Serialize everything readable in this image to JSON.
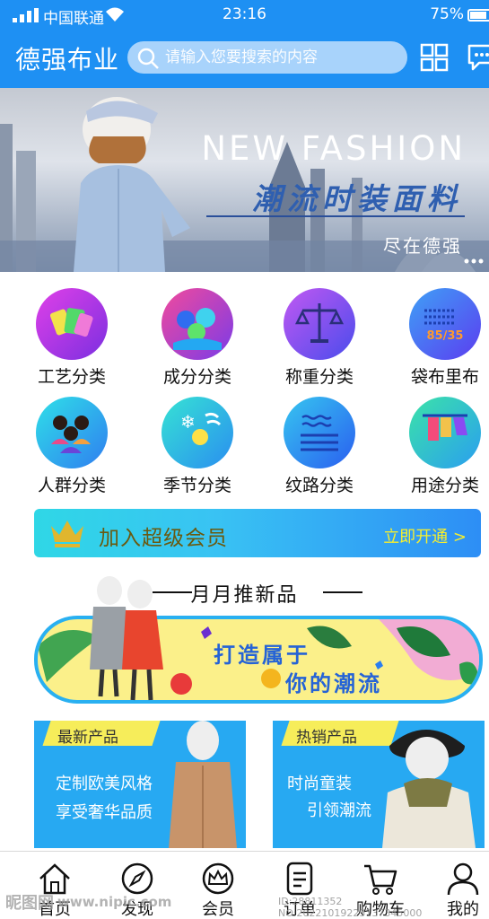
{
  "status_bar": {
    "carrier": "中国联通",
    "time": "23:16",
    "battery": "75%",
    "battery_level": 0.75
  },
  "header": {
    "brand": "德强布业",
    "search_placeholder": "请输入您要搜索的内容",
    "grid_icon": "grid-icon",
    "message_icon": "message-icon"
  },
  "banner": {
    "title": "NEW FASHION",
    "subtitle": "潮流时装面料",
    "tagline": "尽在德强"
  },
  "categories": [
    {
      "label": "工艺分类",
      "icon": "craft-icon"
    },
    {
      "label": "成分分类",
      "icon": "composition-icon"
    },
    {
      "label": "称重分类",
      "icon": "scale-icon"
    },
    {
      "label": "袋布里布",
      "icon": "pocket-lining-icon"
    },
    {
      "label": "人群分类",
      "icon": "people-icon"
    },
    {
      "label": "季节分类",
      "icon": "season-icon"
    },
    {
      "label": "纹路分类",
      "icon": "texture-icon"
    },
    {
      "label": "用途分类",
      "icon": "usage-icon"
    }
  ],
  "scale_badge": "85/35",
  "vip": {
    "title": "加入超级会员",
    "action": "立即开通 >"
  },
  "section": {
    "title": "月月推新品"
  },
  "promo": {
    "line1": "打造属于",
    "line2": "你的潮流"
  },
  "products": [
    {
      "badge": "最新产品",
      "line1": "定制欧美风格",
      "line2": "享受奢华品质"
    },
    {
      "badge": "热销产品",
      "line1": "时尚童装",
      "line2": "引领潮流"
    }
  ],
  "tabs": [
    {
      "label": "首页",
      "icon": "home-icon"
    },
    {
      "label": "发现",
      "icon": "compass-icon"
    },
    {
      "label": "会员",
      "icon": "crown-icon"
    },
    {
      "label": "订单",
      "icon": "order-icon"
    },
    {
      "label": "购物车",
      "icon": "cart-icon"
    },
    {
      "label": "我的",
      "icon": "user-icon"
    }
  ],
  "watermark": {
    "logo": "昵图网",
    "site": "www.nipic.com",
    "id": "ID:28811352 NO:20221019223137345000"
  },
  "colors": {
    "primary": "#1e90f3",
    "vip_text": "#6a5a10",
    "vip_action": "#f6ef2e",
    "card_bg": "#27a9f2",
    "badge_bg": "#f6ed5a"
  }
}
